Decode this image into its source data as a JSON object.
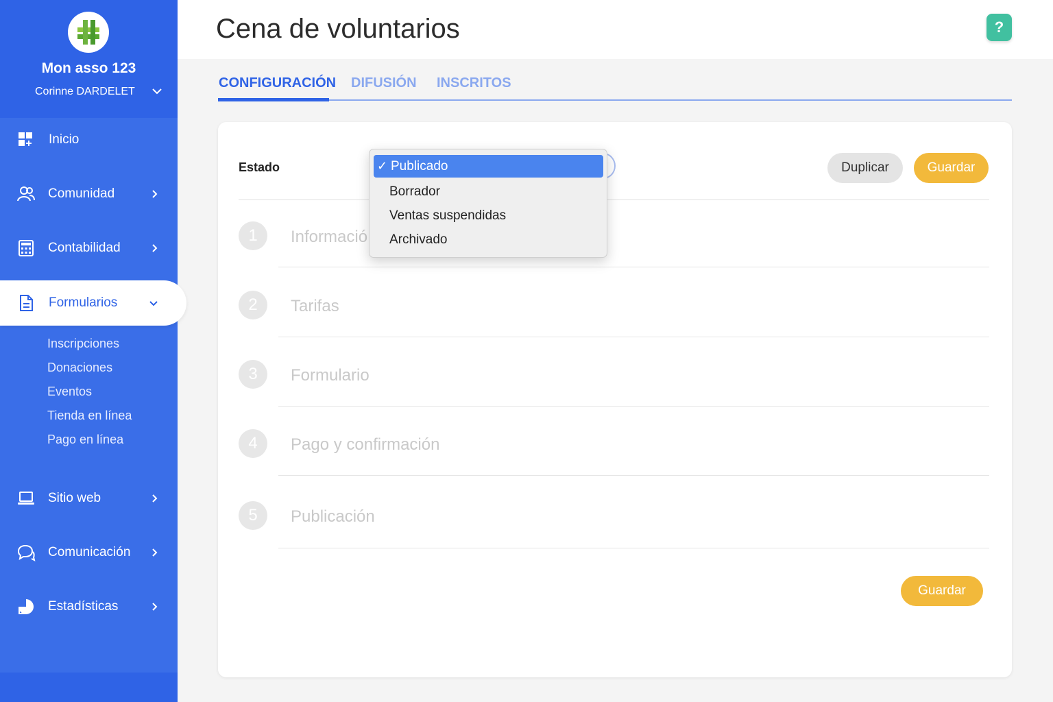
{
  "sidebar": {
    "org_name": "Mon asso 123",
    "user_name": "Corinne DARDELET",
    "items": [
      {
        "label": "Inicio",
        "icon": "dashboard-icon"
      },
      {
        "label": "Comunidad",
        "icon": "users-icon"
      },
      {
        "label": "Contabilidad",
        "icon": "calculator-icon"
      },
      {
        "label": "Formularios",
        "icon": "document-icon"
      },
      {
        "label": "Sitio web",
        "icon": "laptop-icon"
      },
      {
        "label": "Comunicación",
        "icon": "chat-icon"
      },
      {
        "label": "Estadísticas",
        "icon": "pie-chart-icon"
      }
    ],
    "subitems": [
      "Inscripciones",
      "Donaciones",
      "Eventos",
      "Tienda en línea",
      "Pago en línea"
    ]
  },
  "header": {
    "title": "Cena de voluntarios",
    "help_label": "?"
  },
  "tabs": [
    {
      "label": "CONFIGURACIÓN",
      "active": true
    },
    {
      "label": "DIFUSIÓN",
      "active": false
    },
    {
      "label": "INSCRITOS",
      "active": false
    }
  ],
  "form": {
    "estado_label": "Estado",
    "duplicate_label": "Duplicar",
    "save_label": "Guardar",
    "status_options": [
      "Publicado",
      "Borrador",
      "Ventas suspendidas",
      "Archivado"
    ],
    "selected_status": "Publicado",
    "steps": [
      {
        "number": "1",
        "label": "Informació"
      },
      {
        "number": "2",
        "label": "Tarifas"
      },
      {
        "number": "3",
        "label": "Formulario"
      },
      {
        "number": "4",
        "label": "Pago y confirmación"
      },
      {
        "number": "5",
        "label": "Publicación"
      }
    ]
  },
  "colors": {
    "sidebar_bg": "#3a6ee8",
    "accent_blue": "#2f63e6",
    "save_yellow": "#f2b93b",
    "help_green": "#41c0a0"
  }
}
